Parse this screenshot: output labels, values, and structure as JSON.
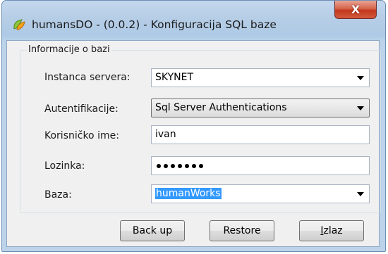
{
  "window": {
    "title": "humansDO - (0.0.2) - Konfiguracija SQL baze",
    "close_label": "X"
  },
  "group": {
    "title": "Informacije o bazi"
  },
  "form": {
    "server": {
      "label": "Instanca servera:",
      "value": "SKYNET"
    },
    "auth": {
      "label": "Autentifikacije:",
      "value": "Sql Server Authentications"
    },
    "username": {
      "label": "Korisničko ime:",
      "value": "ivan"
    },
    "password": {
      "label": "Lozinka:",
      "masked_length": 7
    },
    "database": {
      "label": "Baza:",
      "value": "humanWorks"
    }
  },
  "buttons": {
    "backup": "Back up",
    "restore": "Restore",
    "exit_first": "I",
    "exit_rest": "zlaz"
  },
  "colors": {
    "selection": "#3399ff",
    "close": "#c2381c"
  }
}
